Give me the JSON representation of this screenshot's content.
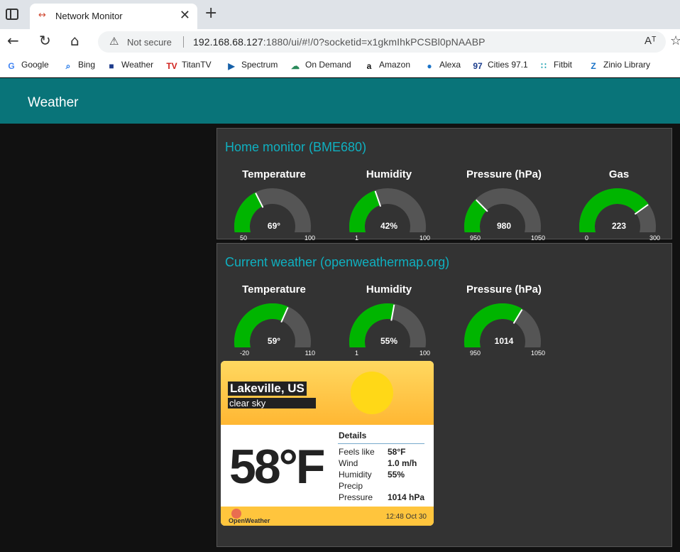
{
  "browser": {
    "tab_title": "Network Monitor",
    "url_host": "192.168.68.127",
    "url_rest": ":1880/ui/#!/0?socketid=x1gkmIhkPCSBl0pNAABP",
    "not_secure": "Not secure",
    "read_aloud": "Aᵀ",
    "bookmarks": [
      {
        "label": "Google",
        "icon": "google-icon",
        "color": "#4285f4",
        "glyph": "G"
      },
      {
        "label": "Bing",
        "icon": "search-icon",
        "color": "#1a73e8",
        "glyph": "⌕"
      },
      {
        "label": "Weather",
        "icon": "weather-channel-icon",
        "color": "#1e3c8c",
        "glyph": "■"
      },
      {
        "label": "TitanTV",
        "icon": "tv-icon",
        "color": "#d0201c",
        "glyph": "TV"
      },
      {
        "label": "Spectrum",
        "icon": "play-icon",
        "color": "#1660a8",
        "glyph": "▶"
      },
      {
        "label": "On Demand",
        "icon": "on-demand-icon",
        "color": "#2a8a5a",
        "glyph": "☁"
      },
      {
        "label": "Amazon",
        "icon": "amazon-icon",
        "color": "#111111",
        "glyph": "a"
      },
      {
        "label": "Alexa",
        "icon": "location-pin-icon",
        "color": "#1a73c8",
        "glyph": "●"
      },
      {
        "label": "Cities 97.1",
        "icon": "radio-icon",
        "color": "#1a3c8c",
        "glyph": "97"
      },
      {
        "label": "Fitbit",
        "icon": "fitbit-icon",
        "color": "#1aa0b0",
        "glyph": "∷"
      },
      {
        "label": "Zinio Library",
        "icon": "zinio-icon",
        "color": "#1a73c8",
        "glyph": "Z"
      }
    ]
  },
  "app": {
    "title": "Weather"
  },
  "home": {
    "title": "Home monitor (BME680)",
    "gauges": [
      {
        "label": "Temperature",
        "value": 69,
        "display": "69°",
        "min": 50,
        "max": 100
      },
      {
        "label": "Humidity",
        "value": 42,
        "display": "42%",
        "min": 1,
        "max": 100
      },
      {
        "label": "Pressure (hPa)",
        "value": 980,
        "display": "980",
        "min": 950,
        "max": 1050
      },
      {
        "label": "Gas",
        "value": 223,
        "display": "223",
        "min": 0,
        "max": 300
      }
    ]
  },
  "current": {
    "title": "Current weather (openweathermap.org)",
    "gauges": [
      {
        "label": "Temperature",
        "value": 59,
        "display": "59°",
        "min": -20,
        "max": 110
      },
      {
        "label": "Humidity",
        "value": 55,
        "display": "55%",
        "min": 1,
        "max": 100
      },
      {
        "label": "Pressure (hPa)",
        "value": 1014,
        "display": "1014",
        "min": 950,
        "max": 1050
      }
    ]
  },
  "card": {
    "city": "Lakeville, US",
    "description": "clear sky",
    "temperature": "58°F",
    "details_title": "Details",
    "details": [
      {
        "label": "Feels like",
        "value": "58°F"
      },
      {
        "label": "Wind",
        "value": "1.0 m/h"
      },
      {
        "label": "Humidity",
        "value": "55%"
      },
      {
        "label": "Precip",
        "value": ""
      },
      {
        "label": "Pressure",
        "value": "1014 hPa"
      }
    ],
    "provider": "OpenWeather",
    "timestamp": "12:48 Oct 30"
  },
  "colors": {
    "gauge_fill": "#00b500",
    "gauge_track": "#555555",
    "header": "#097479",
    "group_title": "#0fb0c0"
  }
}
